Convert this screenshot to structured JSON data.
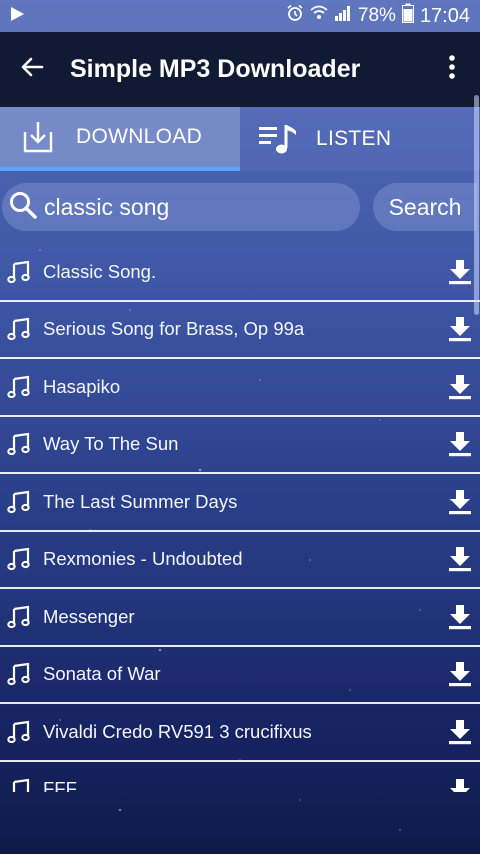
{
  "status_bar": {
    "battery": "78%",
    "time": "17:04",
    "icons": [
      "play-icon",
      "alarm-icon",
      "wifi-icon",
      "signal-icon",
      "battery-icon"
    ]
  },
  "app_bar": {
    "title": "Simple MP3 Downloader",
    "icons": [
      "back-arrow-icon",
      "more-vert-icon"
    ]
  },
  "tabs": [
    {
      "label": "DOWNLOAD",
      "icon": "download-tray-icon",
      "active": true
    },
    {
      "label": "LISTEN",
      "icon": "playlist-note-icon",
      "active": false
    }
  ],
  "search": {
    "value": "classic song",
    "button_label": "Search"
  },
  "songs": [
    {
      "title": "Classic Song."
    },
    {
      "title": "Serious Song for Brass, Op 99a"
    },
    {
      "title": "Hasapiko"
    },
    {
      "title": "Way To The Sun"
    },
    {
      "title": "The Last Summer Days"
    },
    {
      "title": "Rexmonies - Undoubted"
    },
    {
      "title": "Messenger"
    },
    {
      "title": "Sonata of War"
    },
    {
      "title": "Vivaldi Credo RV591 3 crucifixus"
    },
    {
      "title": "FFF"
    }
  ],
  "colors": {
    "app_bar": "#111a33",
    "tab_indicator": "#59a6ff",
    "text": "#ffffff"
  }
}
